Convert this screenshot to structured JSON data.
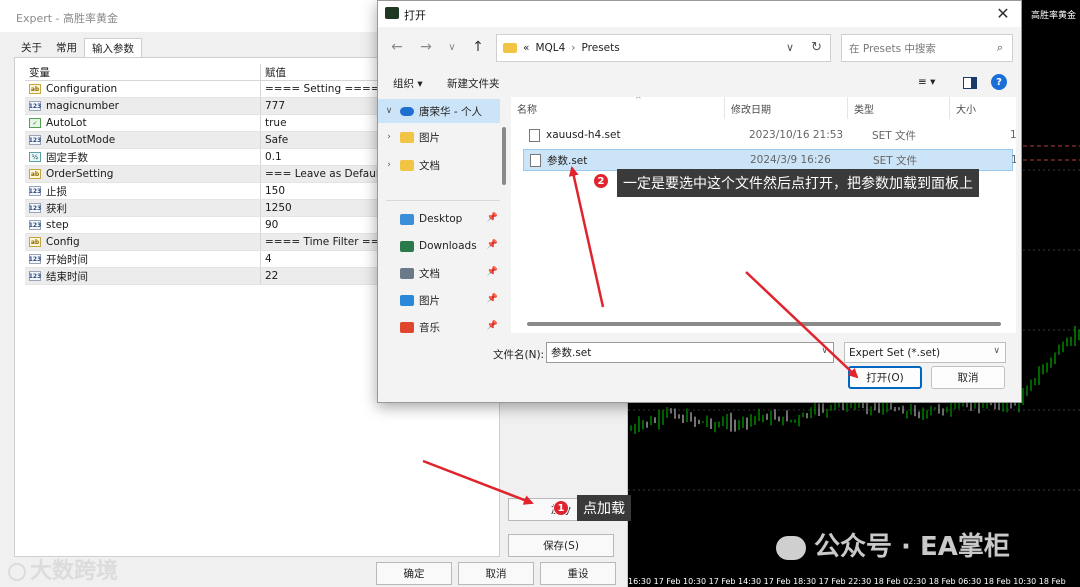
{
  "expert": {
    "title": "Expert - 高胜率黄金",
    "tabs": [
      "关于",
      "常用",
      "输入参数"
    ],
    "active_tab": 2,
    "grid": {
      "headers": [
        "变量",
        "赋值"
      ],
      "rows": [
        {
          "icon": "string-icon",
          "badge": "ab",
          "name": "Configuration",
          "value": "==== Setting ===="
        },
        {
          "icon": "integer-icon",
          "badge": "123",
          "name": "magicnumber",
          "value": "777"
        },
        {
          "icon": "bool-icon",
          "badge": "✓",
          "name": "AutoLot",
          "value": "true"
        },
        {
          "icon": "integer-icon",
          "badge": "123",
          "name": "AutoLotMode",
          "value": "Safe"
        },
        {
          "icon": "double-icon",
          "badge": "½",
          "name": "固定手数",
          "value": "0.1"
        },
        {
          "icon": "string-icon",
          "badge": "ab",
          "name": "OrderSetting",
          "value": "=== Leave as Default ="
        },
        {
          "icon": "integer-icon",
          "badge": "123",
          "name": "止损",
          "value": "150"
        },
        {
          "icon": "integer-icon",
          "badge": "123",
          "name": "获利",
          "value": "1250"
        },
        {
          "icon": "integer-icon",
          "badge": "123",
          "name": "step",
          "value": "90"
        },
        {
          "icon": "string-icon",
          "badge": "ab",
          "name": "Config",
          "value": "==== Time Filter ==="
        },
        {
          "icon": "integer-icon",
          "badge": "123",
          "name": "开始时间",
          "value": "4"
        },
        {
          "icon": "integer-icon",
          "badge": "123",
          "name": "结束时间",
          "value": "22"
        }
      ]
    },
    "load_button": "加载",
    "load_button_visible": "加 y",
    "save_button": "保存(S)",
    "ok_button": "确定",
    "cancel_button": "取消",
    "reset_button": "重设"
  },
  "chart": {
    "symbol_label": "高胜率黄金",
    "time_axis": "16:30    17 Feb 10:30    17 Feb 14:30    17 Feb 18:30    17 Feb 22:30    18 Feb 02:30    18 Feb 06:30    18 Feb 10:30    18 Feb"
  },
  "open_dialog": {
    "title": "打开",
    "close_glyph": "✕",
    "nav": {
      "back": "←",
      "forward": "→",
      "dropdown": "∨",
      "up": "↑"
    },
    "breadcrumb": {
      "overflow": "«",
      "segments": [
        "MQL4",
        "Presets"
      ],
      "separator": "›"
    },
    "search_placeholder": "在 Presets 中搜索",
    "toolbar": {
      "organize": "组织 ▾",
      "new_folder": "新建文件夹",
      "view_glyph": "≡ ▾",
      "help_glyph": "?"
    },
    "tree": [
      {
        "label": "唐荣华 - 个人",
        "chevron": "∨",
        "icon": "cloud-icon",
        "color": "#1f6fd0",
        "selected": true,
        "pinned": false
      },
      {
        "label": "图片",
        "chevron": "›",
        "icon": "folder-icon",
        "color": "#f2c443",
        "selected": false,
        "pinned": false
      },
      {
        "label": "文档",
        "chevron": "›",
        "icon": "folder-icon",
        "color": "#f2c443",
        "selected": false,
        "pinned": false
      },
      {
        "label": "Desktop",
        "chevron": "",
        "icon": "desktop-icon",
        "color": "#3a8fd8",
        "selected": false,
        "pinned": true
      },
      {
        "label": "Downloads",
        "chevron": "",
        "icon": "download-icon",
        "color": "#2a7a4a",
        "selected": false,
        "pinned": true
      },
      {
        "label": "文档",
        "chevron": "",
        "icon": "document-icon",
        "color": "#6a7a8a",
        "selected": false,
        "pinned": true
      },
      {
        "label": "图片",
        "chevron": "",
        "icon": "picture-icon",
        "color": "#2a88d8",
        "selected": false,
        "pinned": true
      },
      {
        "label": "音乐",
        "chevron": "",
        "icon": "music-icon",
        "color": "#e0462e",
        "selected": false,
        "pinned": true
      }
    ],
    "pin_glyph": "📌",
    "columns": [
      "名称",
      "修改日期",
      "类型",
      "大小"
    ],
    "files": [
      {
        "name": "xauusd-h4.set",
        "date": "2023/10/16 21:53",
        "type": "SET 文件",
        "size": "1",
        "selected": false
      },
      {
        "name": "参数.set",
        "date": "2024/3/9 16:26",
        "type": "SET 文件",
        "size": "1",
        "selected": true
      }
    ],
    "filename_label": "文件名(N):",
    "filename_value": "参数.set",
    "filetype_value": "Expert Set (*.set)",
    "open_button": "打开(O)",
    "cancel_button": "取消"
  },
  "annotations": [
    {
      "number": "1",
      "text": "点加载"
    },
    {
      "number": "2",
      "text": "一定是要选中这个文件然后点打开，把参数加载到面板上"
    }
  ],
  "watermarks": {
    "left": "大数跨境",
    "right": "公众号 · EA掌柜"
  },
  "colors": {
    "arrow": "#e0242e",
    "selection": "#cce4f7",
    "primary_border": "#0067c0",
    "chart_bg": "#000000",
    "candle_green": "#00c800"
  }
}
